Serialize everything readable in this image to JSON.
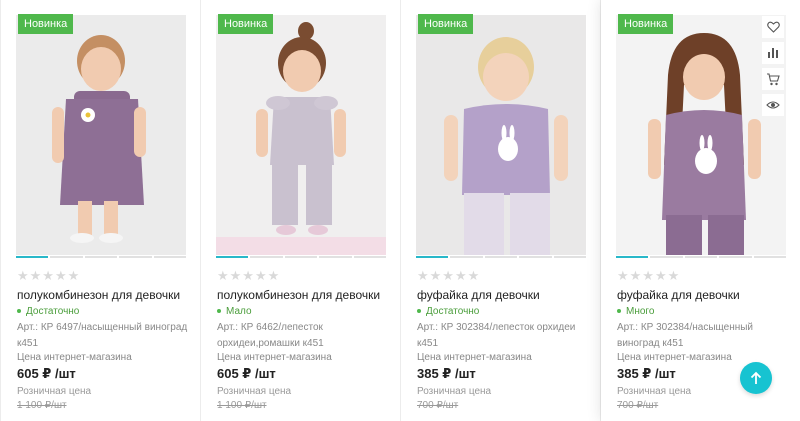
{
  "colors": {
    "accent": "#17c3d1",
    "badge": "#4fb84c",
    "stock": "#4a9d3b",
    "product": "#9a7ba0"
  },
  "products": [
    {
      "badge": "Новинка",
      "rating": "★★★★★",
      "title": "полукомбинезон для девочки",
      "stock": "Достаточно",
      "article": "Арт.: КР 6497/насыщенный виноград к451",
      "price_label": "Цена интернет-магазина",
      "price": "605 ₽ /шт",
      "retail_label": "Розничная цена",
      "old_price": "1 100 ₽/шт"
    },
    {
      "badge": "Новинка",
      "rating": "★★★★★",
      "title": "полукомбинезон для девочки",
      "stock": "Мало",
      "article": "Арт.: КР 6462/лепесток орхидеи,ромашки к451",
      "price_label": "Цена интернет-магазина",
      "price": "605 ₽ /шт",
      "retail_label": "Розничная цена",
      "old_price": "1 100 ₽/шт"
    },
    {
      "badge": "Новинка",
      "rating": "★★★★★",
      "title": "фуфайка для девочки",
      "stock": "Достаточно",
      "article": "Арт.: КР 302384/лепесток орхидеи к451",
      "price_label": "Цена интернет-магазина",
      "price": "385 ₽ /шт",
      "retail_label": "Розничная цена",
      "old_price": "700 ₽/шт"
    },
    {
      "badge": "Новинка",
      "rating": "★★★★★",
      "title": "фуфайка для девочки",
      "stock": "Много",
      "article": "Арт.: КР 302384/насыщенный виноград к451",
      "price_label": "Цена интернет-магазина",
      "price": "385 ₽ /шт",
      "retail_label": "Розничная цена",
      "old_price": "700 ₽/шт"
    }
  ],
  "actions": [
    "heart-icon",
    "compare-icon",
    "cart-icon",
    "eye-icon"
  ],
  "scroll_top_icon": "arrow-up-icon"
}
